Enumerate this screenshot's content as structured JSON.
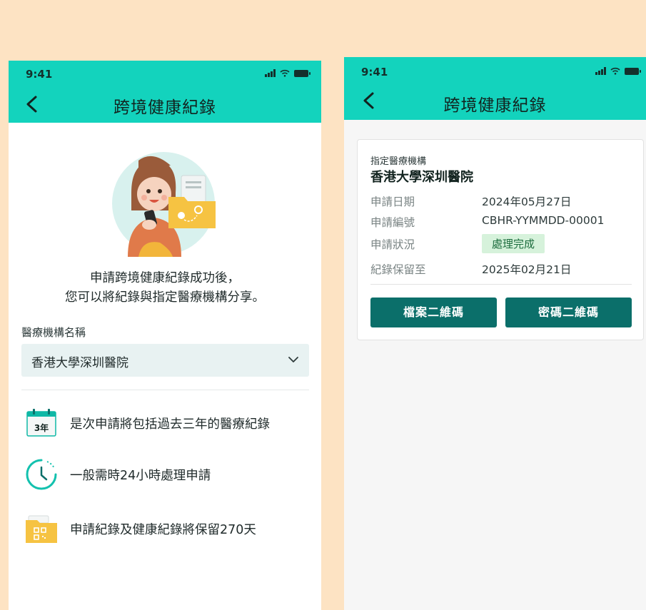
{
  "left": {
    "status": {
      "time": "9:41"
    },
    "header": {
      "title": "跨境健康紀錄"
    },
    "intro": {
      "line1": "申請跨境健康紀錄成功後，",
      "line2": "您可以將紀錄與指定醫療機構分享。"
    },
    "field": {
      "label": "醫療機構名稱",
      "value": "香港大學深圳醫院"
    },
    "info": [
      {
        "icon": "calendar-3yr-icon",
        "badge": "3年",
        "text": "是次申請將包括過去三年的醫療紀錄"
      },
      {
        "icon": "clock-icon",
        "text": "一般需時24小時處理申請"
      },
      {
        "icon": "qr-folder-icon",
        "text": "申請紀錄及健康紀錄將保留270天"
      }
    ]
  },
  "right": {
    "status": {
      "time": "9:41"
    },
    "header": {
      "title": "跨境健康紀錄"
    },
    "card": {
      "label": "指定醫療機構",
      "hospital": "香港大學深圳醫院",
      "rows": [
        {
          "key": "申請日期",
          "value": "2024年05月27日"
        },
        {
          "key": "申請編號",
          "value": "CBHR-YYMMDD-00001"
        },
        {
          "key": "申請狀況",
          "value": "處理完成"
        },
        {
          "key": "紀錄保留至",
          "value": "2025年02月21日"
        }
      ],
      "buttons": {
        "file_qr": "檔案二維碼",
        "password_qr": "密碼二維碼"
      }
    }
  },
  "colors": {
    "header": "#13d3bd",
    "button": "#0b6f6a",
    "badge_bg": "#d6f2db",
    "page_bg": "#fde3c3",
    "folder": "#f6c342"
  }
}
